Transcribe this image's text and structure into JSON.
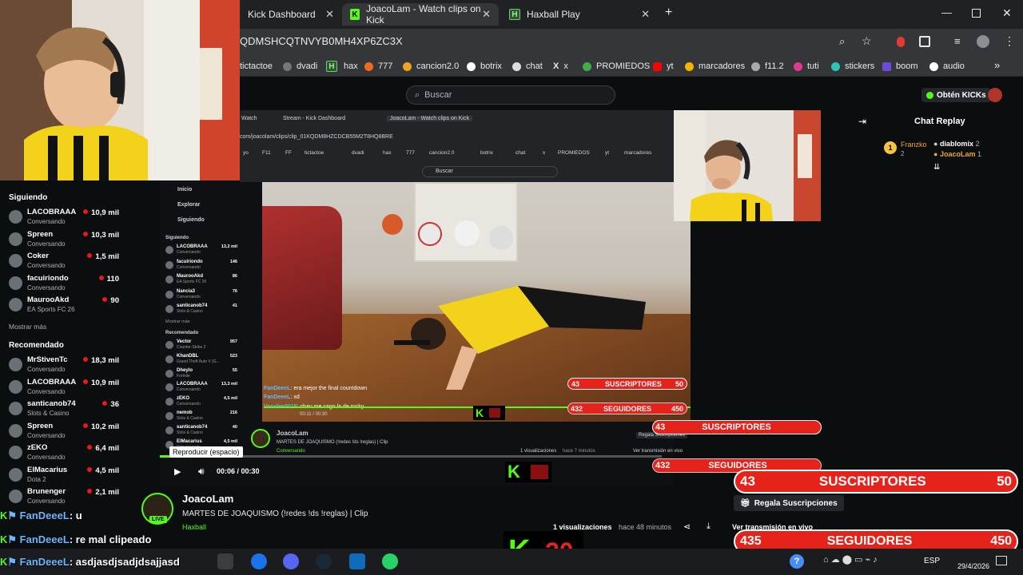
{
  "browser": {
    "tabs": [
      {
        "label": "Kick Dashboard",
        "active": false
      },
      {
        "label": "JoacoLam - Watch clips on Kick",
        "active": true
      },
      {
        "label": "Haxball Play",
        "active": false
      }
    ],
    "url": "QDMSHCQTNVYB0MH4XP6ZC3X",
    "bookmarks": [
      "tictactoe",
      "dvadi",
      "hax",
      "777",
      "cancion2.0",
      "botrix",
      "chat",
      "x",
      "PROMIEDOS",
      "yt",
      "marcadores",
      "f11.2",
      "tuti",
      "stickers",
      "boom",
      "audio"
    ]
  },
  "kick": {
    "search_placeholder": "Buscar",
    "get_kicks": "Obtén KICKs",
    "chat_replay_title": "Chat Replay"
  },
  "sidebar": {
    "following_title": "Siguiendo",
    "following": [
      {
        "name": "LACOBRAAA",
        "sub": "Conversando",
        "viewers": "10,9 mil"
      },
      {
        "name": "Spreen",
        "sub": "Conversando",
        "viewers": "10,3 mil"
      },
      {
        "name": "Coker",
        "sub": "Conversando",
        "viewers": "1,5 mil"
      },
      {
        "name": "facuiriondo",
        "sub": "Conversando",
        "viewers": "110"
      },
      {
        "name": "MaurooAkd",
        "sub": "EA Sports FC 26",
        "viewers": "90"
      }
    ],
    "show_more": "Mostrar más",
    "recommended_title": "Recomendado",
    "recommended": [
      {
        "name": "MrStivenTc",
        "sub": "Conversando",
        "viewers": "18,3 mil"
      },
      {
        "name": "LACOBRAAA",
        "sub": "Conversando",
        "viewers": "10,9 mil"
      },
      {
        "name": "santicanob74",
        "sub": "Slots & Casino",
        "viewers": "36"
      },
      {
        "name": "Spreen",
        "sub": "Conversando",
        "viewers": "10,2 mil"
      },
      {
        "name": "zEKO",
        "sub": "Conversando",
        "viewers": "6,4 mil"
      },
      {
        "name": "ElMacarius",
        "sub": "Dota 2",
        "viewers": "4,5 mil"
      },
      {
        "name": "Brunenger",
        "sub": "Conversando",
        "viewers": "2,1 mil"
      }
    ]
  },
  "inner": {
    "tabs": [
      "Watch",
      "Stream - Kick Dashboard",
      "JoacoLam - Watch clips on Kick"
    ],
    "url": "com/joacolam/clips/clip_01KQDM8HZCDCB55M2T8HQ8BRE",
    "bookmarks": [
      "yo",
      "F11",
      "FF",
      "tictactoe",
      "dvadi",
      "hax",
      "777",
      "cancion2.0",
      "botrix",
      "chat",
      "x",
      "PROMIEDOS",
      "yt",
      "marcadores",
      "f11.2"
    ],
    "search": "Buscar",
    "nav": [
      "Inicio",
      "Explorar",
      "Siguiendo"
    ],
    "following_title": "Siguiendo",
    "following": [
      {
        "name": "LACOBRAAA",
        "sub": "Conversando",
        "viewers": "13,2 mil"
      },
      {
        "name": "facuiriondo",
        "sub": "Conversando",
        "viewers": "146"
      },
      {
        "name": "MaurooAkd",
        "sub": "EA Sports FC 26",
        "viewers": "86"
      },
      {
        "name": "Nancia3",
        "sub": "Conversando",
        "viewers": "76"
      },
      {
        "name": "santicanob74",
        "sub": "Slots & Casino",
        "viewers": "41"
      }
    ],
    "show_more": "Mostrar más",
    "recommended_title": "Recomendado",
    "recommended": [
      {
        "name": "Vector",
        "sub": "Counter-Strike 2",
        "viewers": "957"
      },
      {
        "name": "KhanDBL",
        "sub": "Grand Theft Auto V (G...",
        "viewers": "523"
      },
      {
        "name": "Dheylo",
        "sub": "Fortnite",
        "viewers": "55"
      },
      {
        "name": "LACOBRAAA",
        "sub": "Conversando",
        "viewers": "13,3 mil"
      },
      {
        "name": "zEKO",
        "sub": "Conversando",
        "viewers": "4,5 mil"
      },
      {
        "name": "nemob",
        "sub": "Slots & Casino",
        "viewers": "216"
      },
      {
        "name": "santicanob74",
        "sub": "Slots & Casino",
        "viewers": "40"
      },
      {
        "name": "ElMacarius",
        "sub": "Conversando",
        "viewers": "4,5 mil"
      }
    ],
    "chat": [
      {
        "user": "FanDeeeL",
        "msg": ": era mejor the final countdown"
      },
      {
        "user": "FanDeeeL",
        "msg": ": xd"
      },
      {
        "user": "Vaaalen0015",
        "msg": ": chau me cago la de rocky"
      }
    ],
    "time": "00:11 / 00:30",
    "channel": "JoacoLam",
    "title": "MARTES DE JOAQUISMO (!redes !ds !reglas) | Clip",
    "category": "Conversando",
    "views": "1 visualizaciones",
    "ago": "hace 7 minutos",
    "cta": "Regala Suscripciones",
    "live_link": "Ver transmisión en vivo"
  },
  "player": {
    "tooltip": "Reproducir (espacio)",
    "time": "00:06 / 00:30"
  },
  "clip": {
    "channel": "JoacoLam",
    "title": "MARTES DE JOAQUISMO (!redes !ds !reglas) | Clip",
    "category": "Haxball",
    "live_badge": "LIVE",
    "views": "1 visualizaciones",
    "ago": "hace 48 minutos",
    "live_link": "Ver transmisión en vivo"
  },
  "chat_replay": [
    {
      "badge": "1",
      "user": "Franzko",
      "count": "2",
      "gift": "diablomix",
      "gift_count": "2"
    },
    {
      "user": "JoacoLam",
      "count": "1"
    }
  ],
  "goals": {
    "subs_label": "SUSCRIPTORES",
    "subs_current": "43",
    "subs_goal": "50",
    "subs_cta": "Regala Suscripciones",
    "followers_label": "SEGUIDORES",
    "followers_current": "435",
    "followers_goal": "450",
    "inner_followers_current": "432",
    "k_count": "20"
  },
  "overlay_chat": [
    {
      "user": "FanDeeeL",
      "msg": ": u"
    },
    {
      "user": "FanDeeeL",
      "msg": ": re mal clipeado"
    },
    {
      "user": "FanDeeeL",
      "msg": ": asdjasdjsadjdsajjasd"
    }
  ],
  "taskbar": {
    "lang": "ESP",
    "date": "29/4/2026"
  },
  "colors": {
    "kick_green": "#53fc18",
    "goal_red": "#e5231b",
    "bg": "#0b0e0f"
  }
}
